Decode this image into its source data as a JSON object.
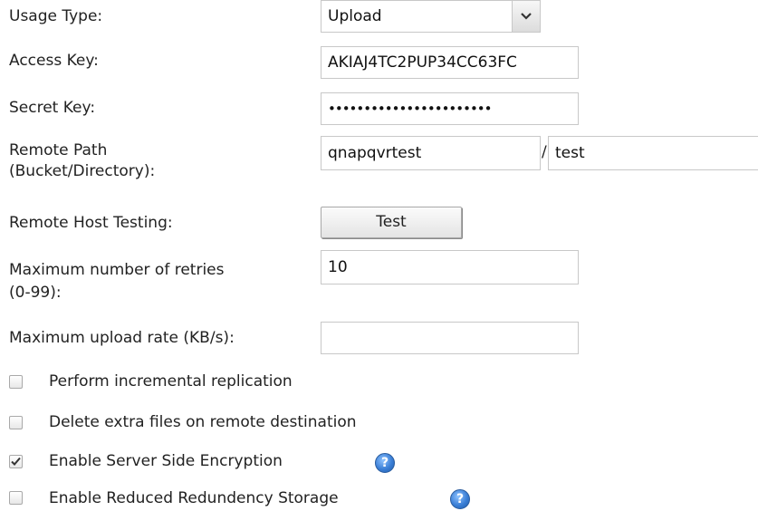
{
  "form": {
    "usage_type": {
      "label": "Usage Type:",
      "value": "Upload"
    },
    "access_key": {
      "label": "Access Key:",
      "value": "AKIAJ4TC2PUP34CC63FC"
    },
    "secret_key": {
      "label": "Secret Key:",
      "value": "•••••••••••••••••••••••"
    },
    "remote_path": {
      "label_line1": "Remote Path",
      "label_line2": "(Bucket/Directory):",
      "bucket": "qnapqvrtest",
      "separator": "/",
      "directory": "test"
    },
    "remote_host_testing": {
      "label": "Remote Host Testing:",
      "button": "Test"
    },
    "max_retries": {
      "label_line1": "Maximum number of retries",
      "label_line2": "(0-99):",
      "value": "10"
    },
    "max_upload_rate": {
      "label": "Maximum upload rate (KB/s):",
      "value": ""
    },
    "options": [
      {
        "label": "Perform incremental replication",
        "checked": false,
        "help": false
      },
      {
        "label": "Delete extra files on remote destination",
        "checked": false,
        "help": false
      },
      {
        "label": "Enable Server Side Encryption",
        "checked": true,
        "help": true
      },
      {
        "label": "Enable Reduced Redundency Storage",
        "checked": false,
        "help": true
      }
    ]
  },
  "icons": {
    "dropdown": "chevron-down-icon",
    "help": "help-icon",
    "check": "checkmark-icon"
  },
  "colors": {
    "border": "#c8c8c8",
    "help_blue": "#3b7fd6"
  }
}
